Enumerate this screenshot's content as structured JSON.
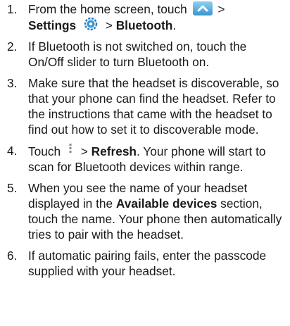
{
  "steps": [
    {
      "number": "1.",
      "parts": {
        "a": "From the home screen, touch",
        "b": " >",
        "c": "Settings",
        "d": " > ",
        "e": "Bluetooth",
        "f": "."
      },
      "icons": [
        "up-arrow-app-icon",
        "settings-icon"
      ]
    },
    {
      "number": "2.",
      "text": "If Bluetooth is not switched on, touch the On/Off slider to turn Bluetooth on."
    },
    {
      "number": "3.",
      "text": "Make sure that the headset is discoverable, so that your phone can find the headset. Refer to the instructions that came with the headset to find out how to set it to discoverable mode."
    },
    {
      "number": "4.",
      "parts": {
        "a": "Touch",
        "b": " > ",
        "c": "Refresh",
        "d": ". Your phone will start to scan for Bluetooth devices within range."
      },
      "icons": [
        "menu-dots-icon"
      ]
    },
    {
      "number": "5.",
      "parts": {
        "a": "When you see the name of your headset displayed in the ",
        "b": "Available devices",
        "c": " section, touch the name. Your phone then automatically tries to pair with the headset."
      }
    },
    {
      "number": "6.",
      "text": "If automatic pairing fails, enter the passcode supplied with your headset."
    }
  ],
  "colors": {
    "text": "#1a1a1a",
    "icon_blue": "#3a95cc",
    "settings_icon_blue": "#2a7fc4"
  }
}
